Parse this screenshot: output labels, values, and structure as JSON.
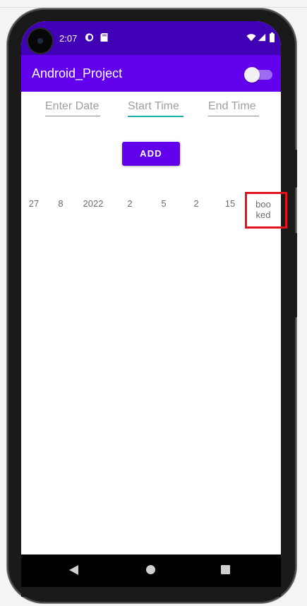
{
  "status_bar": {
    "time": "2:07",
    "icons": [
      "notification-icon",
      "sd-card-icon",
      "wifi-icon",
      "signal-icon",
      "battery-icon"
    ]
  },
  "app_bar": {
    "title": "Android_Project",
    "toggle_state": "off"
  },
  "form": {
    "date_placeholder": "Enter Date",
    "start_time_placeholder": "Start Time",
    "end_time_placeholder": "End Time",
    "add_label": "ADD"
  },
  "booking_row": {
    "day": "27",
    "month": "8",
    "year": "2022",
    "v4": "2",
    "v5": "5",
    "v6": "2",
    "v7": "15",
    "status_line1": "boo",
    "status_line2": "ked"
  },
  "nav_bar": {
    "buttons": [
      "back",
      "home",
      "recents"
    ]
  },
  "colors": {
    "status_bar": "#3f00b6",
    "app_bar": "#6200ee",
    "accent": "#18b0a8",
    "highlight": "#e0141c"
  }
}
